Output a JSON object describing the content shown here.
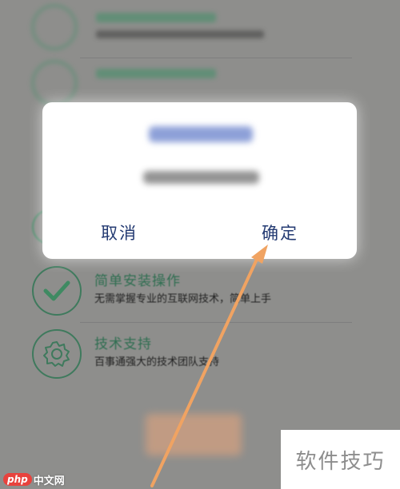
{
  "dialog": {
    "cancel_label": "取消",
    "confirm_label": "确定"
  },
  "features": [
    {
      "title": "简单安装操作",
      "description": "无需掌握专业的互联网技术，简单上手",
      "icon": "checkmark-icon"
    },
    {
      "title": "技术支持",
      "description": "百事通强大的技术团队支持",
      "icon": "gear-icon"
    }
  ],
  "watermark": {
    "site_badge": "php",
    "site_name": "中文网",
    "brand_text": "软件技巧"
  },
  "colors": {
    "overlay": "#8e8e8c",
    "accent_green": "#3f7a5d",
    "button_text": "#233a72",
    "arrow": "#f0a362"
  }
}
